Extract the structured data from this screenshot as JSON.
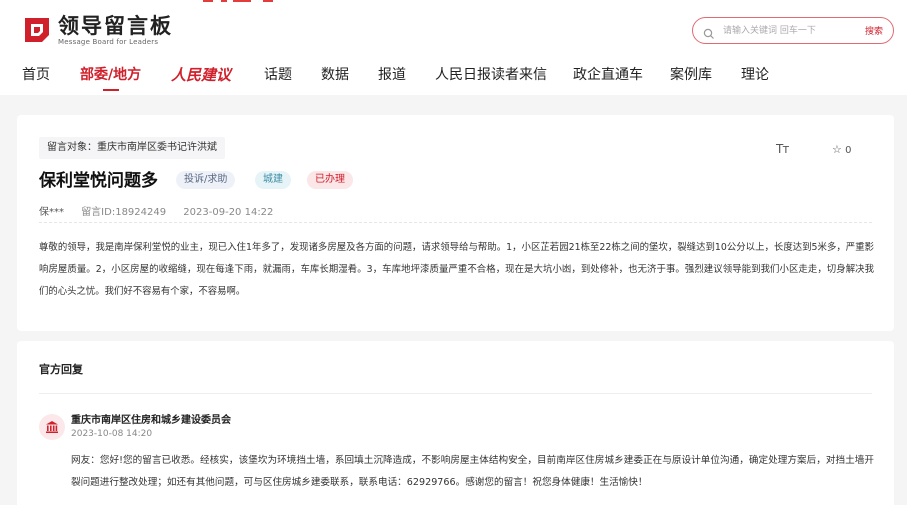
{
  "brand": {
    "name": "领导留言板",
    "subtitle": "Message Board for Leaders",
    "accent": "#d0202c"
  },
  "search": {
    "placeholder": "请输入关键词 回车一下",
    "button_label": "搜索"
  },
  "nav": {
    "items": [
      {
        "label": "首页"
      },
      {
        "label": "部委/地方"
      },
      {
        "label": "人民建议"
      },
      {
        "label": "话题"
      },
      {
        "label": "数据"
      },
      {
        "label": "报道"
      },
      {
        "label": "人民日报读者来信"
      },
      {
        "label": "政企直通车"
      },
      {
        "label": "案例库"
      },
      {
        "label": "理论"
      }
    ],
    "active_index": 1
  },
  "message": {
    "target": "留言对象：重庆市南岸区委书记许洪斌",
    "title": "保利堂悦问题多",
    "tags": {
      "type": "投诉/求助",
      "field": "城建",
      "status": "已办理"
    },
    "font_toggle": "Tт",
    "favorite_count": "0",
    "author": "保***",
    "message_id": "留言ID:18924249",
    "time": "2023-09-20 14:22",
    "content": "尊敬的领导，我是南岸保利堂悦的业主，现已入住1年多了，发现诸多房屋及各方面的问题，请求领导给与帮助。1，小区芷若园21栋至22栋之间的堡坎，裂缝达到10公分以上，长度达到5米多，严重影响房屋质量。2，小区房屋的收缩缝，现在每逢下雨，就漏雨，车库长期湿肴。3，车库地坪漆质量严重不合格，现在是大坑小凼，到处修补，也无济于事。强烈建议领导能到我们小区走走，切身解决我们的心头之忧。我们好不容易有个家，不容易啊。"
  },
  "reply": {
    "heading": "官方回复",
    "org_icon": "government-building-icon",
    "org_name": "重庆市南岸区住房和城乡建设委员会",
    "time": "2023-10-08 14:20",
    "content": "网友：您好!您的留言已收悉。经核实，该堡坎为环境挡土墙，系回填土沉降造成，不影响房屋主体结构安全，目前南岸区住房城乡建委正在与原设计单位沟通，确定处理方案后，对挡土墙开裂问题进行整改处理；如还有其他问题，可与区住房城乡建委联系，联系电话：62929766。感谢您的留言！祝您身体健康！生活愉快！"
  }
}
